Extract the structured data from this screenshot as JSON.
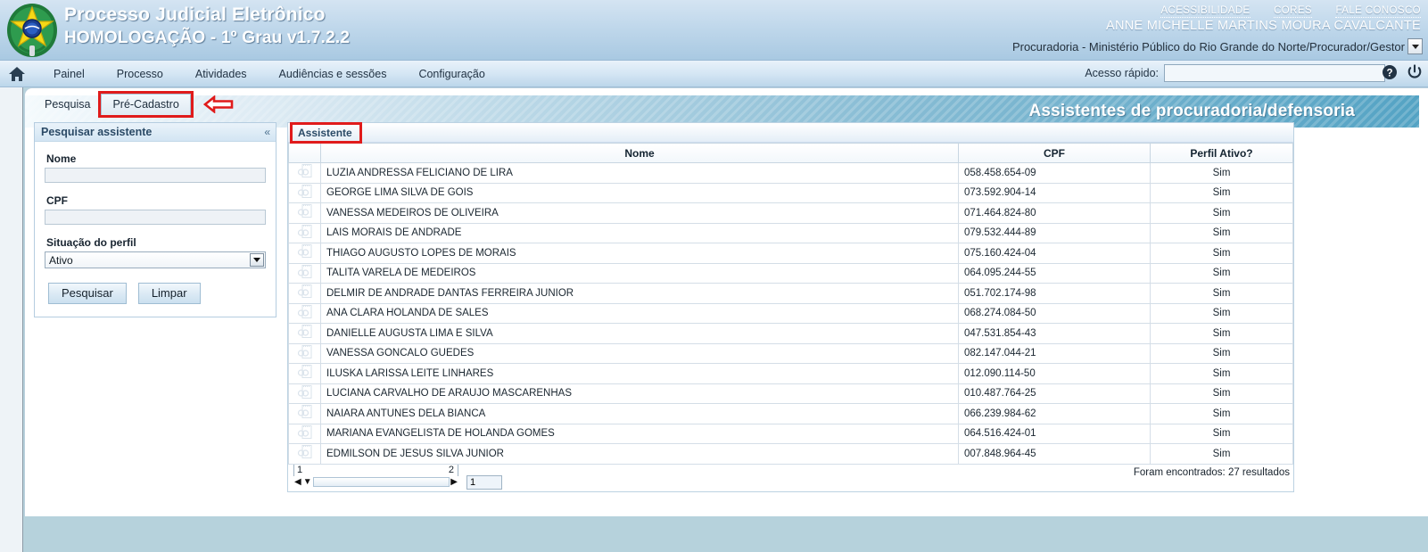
{
  "header": {
    "system_title": "Processo Judicial Eletrônico",
    "system_subtitle": "HOMOLOGAÇÃO - 1º Grau v1.7.2.2",
    "links": [
      {
        "label": "ACESSIBILIDADE",
        "name": "accessibility-link"
      },
      {
        "label": "CORES",
        "name": "colors-link"
      },
      {
        "label": "FALE CONOSCO",
        "name": "contact-us-link"
      }
    ],
    "user_name": "ANNE MICHELLE MARTINS MOURA CAVALCANTE",
    "profile_selected": "Procuradoria - Ministério Público do Rio Grande do Norte/Procurador/Gestor",
    "coat_of_arms_icon": "brasao-republica-icon"
  },
  "nav": {
    "home_icon": "home-icon",
    "items": [
      {
        "label": "Painel",
        "name": "nav-item-painel"
      },
      {
        "label": "Processo",
        "name": "nav-item-processo"
      },
      {
        "label": "Atividades",
        "name": "nav-item-atividades"
      },
      {
        "label": "Audiências e sessões",
        "name": "nav-item-audiencias-e-sessoes"
      },
      {
        "label": "Configuração",
        "name": "nav-item-configuracao"
      }
    ],
    "quick_access_label": "Acesso rápido:",
    "quick_access_value": "",
    "quick_access_placeholder": "",
    "help_icon": "help-icon",
    "logout_icon": "power-logout-icon"
  },
  "page": {
    "banner_title": "Assistentes de procuradoria/defensoria",
    "tabs": [
      {
        "label": "Pesquisa",
        "name": "tab-pesquisa",
        "active": true
      },
      {
        "label": "Pré-Cadastro",
        "name": "tab-pre-cadastro",
        "active": false,
        "highlighted": true
      }
    ],
    "annotation_arrow": "left-pointing-arrow-annotation"
  },
  "search_panel": {
    "title": "Pesquisar assistente",
    "collapse_glyph": "«",
    "fields": {
      "nome_label": "Nome",
      "nome_value": "",
      "cpf_label": "CPF",
      "cpf_value": "",
      "situacao_label": "Situação do perfil",
      "situacao_value": "Ativo"
    },
    "buttons": {
      "search_label": "Pesquisar",
      "clear_label": "Limpar"
    }
  },
  "results": {
    "tab_label": "Assistente",
    "columns": [
      "",
      "Nome",
      "CPF",
      "Perfil Ativo?"
    ],
    "row_icon": "view-record-icon",
    "rows": [
      {
        "nome": "LUZIA ANDRESSA FELICIANO DE LIRA",
        "cpf": "058.458.654-09",
        "ativo": "Sim"
      },
      {
        "nome": "GEORGE LIMA SILVA DE GOIS",
        "cpf": "073.592.904-14",
        "ativo": "Sim"
      },
      {
        "nome": "VANESSA MEDEIROS DE OLIVEIRA",
        "cpf": "071.464.824-80",
        "ativo": "Sim"
      },
      {
        "nome": "LAIS MORAIS DE ANDRADE",
        "cpf": "079.532.444-89",
        "ativo": "Sim"
      },
      {
        "nome": "THIAGO AUGUSTO LOPES DE MORAIS",
        "cpf": "075.160.424-04",
        "ativo": "Sim"
      },
      {
        "nome": "TALITA VARELA DE MEDEIROS",
        "cpf": "064.095.244-55",
        "ativo": "Sim"
      },
      {
        "nome": "DELMIR DE ANDRADE DANTAS FERREIRA JUNIOR",
        "cpf": "051.702.174-98",
        "ativo": "Sim"
      },
      {
        "nome": "ANA CLARA HOLANDA DE SALES",
        "cpf": "068.274.084-50",
        "ativo": "Sim"
      },
      {
        "nome": "DANIELLE AUGUSTA LIMA E SILVA",
        "cpf": "047.531.854-43",
        "ativo": "Sim"
      },
      {
        "nome": "VANESSA GONCALO GUEDES",
        "cpf": "082.147.044-21",
        "ativo": "Sim"
      },
      {
        "nome": "ILUSKA LARISSA LEITE LINHARES",
        "cpf": "012.090.114-50",
        "ativo": "Sim"
      },
      {
        "nome": "LUCIANA CARVALHO DE ARAUJO MASCARENHAS",
        "cpf": "010.487.764-25",
        "ativo": "Sim"
      },
      {
        "nome": "NAIARA ANTUNES DELA BIANCA",
        "cpf": "066.239.984-62",
        "ativo": "Sim"
      },
      {
        "nome": "MARIANA EVANGELISTA DE HOLANDA GOMES",
        "cpf": "064.516.424-01",
        "ativo": "Sim"
      },
      {
        "nome": "EDMILSON DE JESUS SILVA JUNIOR",
        "cpf": "007.848.964-45",
        "ativo": "Sim"
      }
    ],
    "pagination": {
      "page_marks": [
        "1",
        "2"
      ],
      "current_page_value": "1",
      "prev_glyph": "◀",
      "next_glyph": "▶",
      "results_text": "Foram encontrados: 27 resultados"
    }
  },
  "colors": {
    "header_blue": "#a9c9e2",
    "banner_accent": "#54a3c4",
    "annotation_red": "#e01b1b",
    "body_bg": "#b6d2dc"
  }
}
